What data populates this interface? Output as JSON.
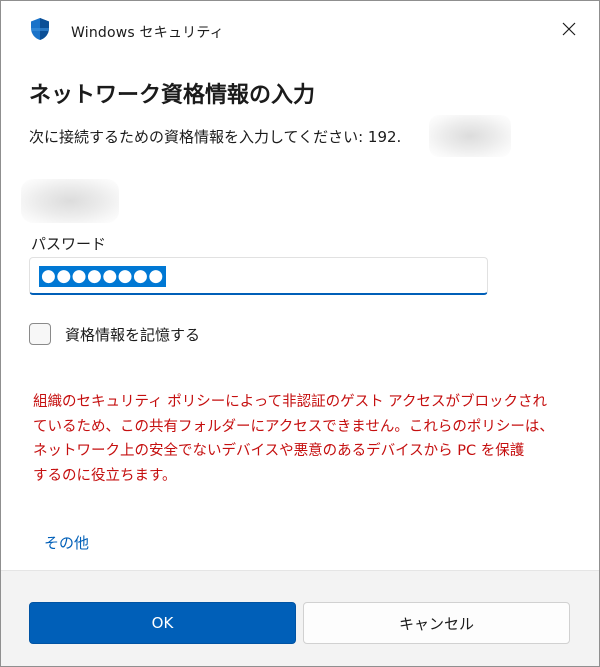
{
  "window": {
    "app_title": "Windows セキュリティ",
    "app_icon": "shield-icon",
    "close_icon": "close-icon"
  },
  "dialog": {
    "heading": "ネットワーク資格情報の入力",
    "instruction": "次に接続するための資格情報を入力してください: 192.",
    "password_label": "パスワード",
    "password_value": "●●●●●●●●",
    "remember_label": "資格情報を記憶する",
    "remember_checked": false,
    "warning_lines": [
      "組織のセキュリティ ポリシーによって非認証のゲスト アクセスがブロックされ",
      "ているため、この共有フォルダーにアクセスできません。これらのポリシーは、",
      "ネットワーク上の安全でないデバイスや悪意のあるデバイスから PC を保護",
      "するのに役立ちます。"
    ],
    "more_link": "その他"
  },
  "footer": {
    "ok_label": "OK",
    "cancel_label": "キャンセル"
  },
  "colors": {
    "accent": "#005fb8",
    "warning_text": "#c50f0f",
    "selection": "#0078d4"
  }
}
